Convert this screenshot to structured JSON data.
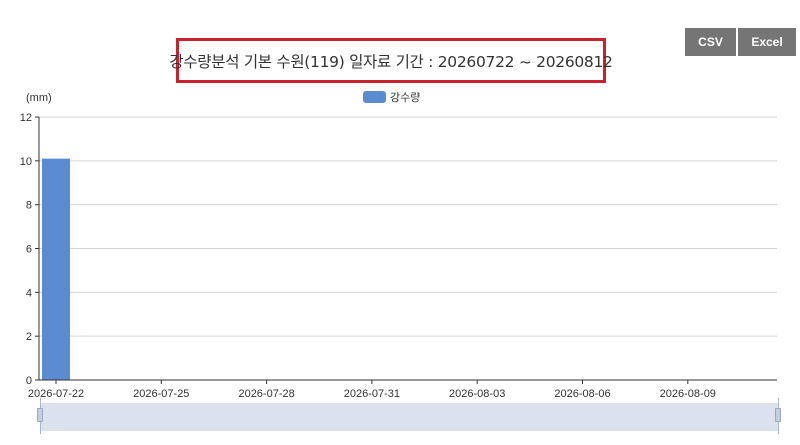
{
  "toolbar": {
    "csv_label": "CSV",
    "excel_label": "Excel"
  },
  "chart_data": {
    "type": "bar",
    "title": "강수량분석 기본 수원(119) 일자료 기간 : 20260722 ~ 20260812",
    "ylabel": "(mm)",
    "series": [
      {
        "name": "강수량",
        "color": "#5b8bd0",
        "values": [
          10.1
        ]
      }
    ],
    "categories": [
      "2026-07-22"
    ],
    "x_tick_labels": [
      "2026-07-22",
      "2026-07-25",
      "2026-07-28",
      "2026-07-31",
      "2026-08-03",
      "2026-08-06",
      "2026-08-09"
    ],
    "y_ticks": [
      0,
      2,
      4,
      6,
      8,
      10,
      12
    ],
    "ylim": [
      0,
      12
    ],
    "grid": true,
    "legend": "top-center"
  }
}
